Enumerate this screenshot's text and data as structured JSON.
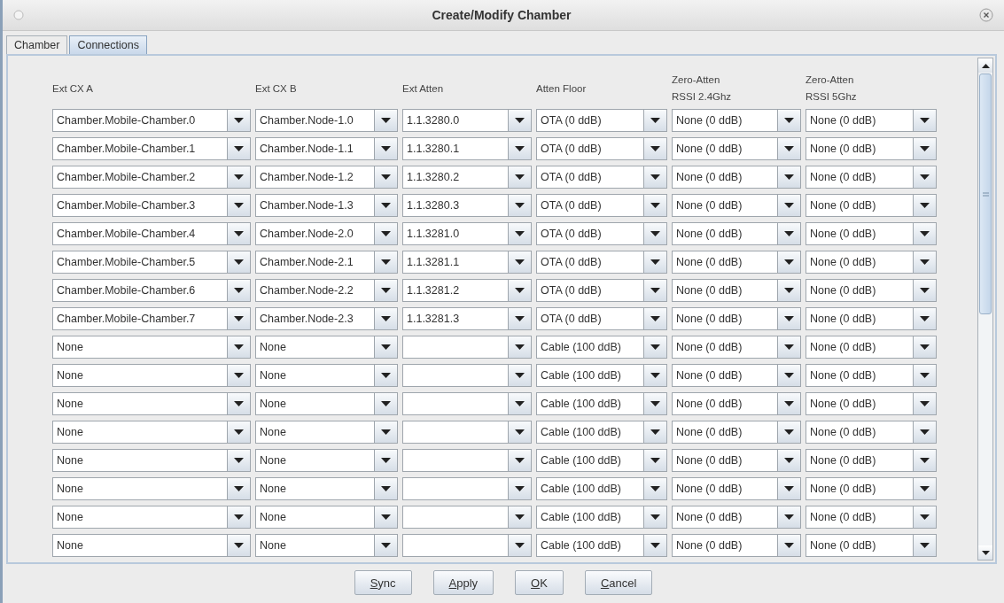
{
  "window": {
    "title": "Create/Modify Chamber"
  },
  "tabs": [
    {
      "label": "Chamber",
      "selected": false
    },
    {
      "label": "Connections",
      "selected": true
    }
  ],
  "table": {
    "columns": [
      {
        "label": "Ext CX A"
      },
      {
        "label": "Ext CX B"
      },
      {
        "label": "Ext Atten"
      },
      {
        "label": "Atten Floor"
      },
      {
        "label": "Zero-Atten\nRSSI 2.4Ghz"
      },
      {
        "label": "Zero-Atten\nRSSI 5Ghz"
      }
    ],
    "rows": [
      {
        "ext_cx_a": "Chamber.Mobile-Chamber.0",
        "ext_cx_b": "Chamber.Node-1.0",
        "ext_atten": "1.1.3280.0",
        "atten_floor": "OTA (0 ddB)",
        "rssi_24": "None (0 ddB)",
        "rssi_5": "None (0 ddB)"
      },
      {
        "ext_cx_a": "Chamber.Mobile-Chamber.1",
        "ext_cx_b": "Chamber.Node-1.1",
        "ext_atten": "1.1.3280.1",
        "atten_floor": "OTA (0 ddB)",
        "rssi_24": "None (0 ddB)",
        "rssi_5": "None (0 ddB)"
      },
      {
        "ext_cx_a": "Chamber.Mobile-Chamber.2",
        "ext_cx_b": "Chamber.Node-1.2",
        "ext_atten": "1.1.3280.2",
        "atten_floor": "OTA (0 ddB)",
        "rssi_24": "None (0 ddB)",
        "rssi_5": "None (0 ddB)"
      },
      {
        "ext_cx_a": "Chamber.Mobile-Chamber.3",
        "ext_cx_b": "Chamber.Node-1.3",
        "ext_atten": "1.1.3280.3",
        "atten_floor": "OTA (0 ddB)",
        "rssi_24": "None (0 ddB)",
        "rssi_5": "None (0 ddB)"
      },
      {
        "ext_cx_a": "Chamber.Mobile-Chamber.4",
        "ext_cx_b": "Chamber.Node-2.0",
        "ext_atten": "1.1.3281.0",
        "atten_floor": "OTA (0 ddB)",
        "rssi_24": "None (0 ddB)",
        "rssi_5": "None (0 ddB)"
      },
      {
        "ext_cx_a": "Chamber.Mobile-Chamber.5",
        "ext_cx_b": "Chamber.Node-2.1",
        "ext_atten": "1.1.3281.1",
        "atten_floor": "OTA (0 ddB)",
        "rssi_24": "None (0 ddB)",
        "rssi_5": "None (0 ddB)"
      },
      {
        "ext_cx_a": "Chamber.Mobile-Chamber.6",
        "ext_cx_b": "Chamber.Node-2.2",
        "ext_atten": "1.1.3281.2",
        "atten_floor": "OTA (0 ddB)",
        "rssi_24": "None (0 ddB)",
        "rssi_5": "None (0 ddB)"
      },
      {
        "ext_cx_a": "Chamber.Mobile-Chamber.7",
        "ext_cx_b": "Chamber.Node-2.3",
        "ext_atten": "1.1.3281.3",
        "atten_floor": "OTA (0 ddB)",
        "rssi_24": "None (0 ddB)",
        "rssi_5": "None (0 ddB)"
      },
      {
        "ext_cx_a": "None",
        "ext_cx_b": "None",
        "atten_floor": "Cable (100 ddB)",
        "rssi_24": "None (0 ddB)",
        "rssi_5": "None (0 ddB)"
      },
      {
        "ext_cx_a": "None",
        "ext_cx_b": "None",
        "atten_floor": "Cable (100 ddB)",
        "rssi_24": "None (0 ddB)",
        "rssi_5": "None (0 ddB)"
      },
      {
        "ext_cx_a": "None",
        "ext_cx_b": "None",
        "atten_floor": "Cable (100 ddB)",
        "rssi_24": "None (0 ddB)",
        "rssi_5": "None (0 ddB)"
      },
      {
        "ext_cx_a": "None",
        "ext_cx_b": "None",
        "atten_floor": "Cable (100 ddB)",
        "rssi_24": "None (0 ddB)",
        "rssi_5": "None (0 ddB)"
      },
      {
        "ext_cx_a": "None",
        "ext_cx_b": "None",
        "atten_floor": "Cable (100 ddB)",
        "rssi_24": "None (0 ddB)",
        "rssi_5": "None (0 ddB)"
      },
      {
        "ext_cx_a": "None",
        "ext_cx_b": "None",
        "atten_floor": "Cable (100 ddB)",
        "rssi_24": "None (0 ddB)",
        "rssi_5": "None (0 ddB)"
      },
      {
        "ext_cx_a": "None",
        "ext_cx_b": "None",
        "atten_floor": "Cable (100 ddB)",
        "rssi_24": "None (0 ddB)",
        "rssi_5": "None (0 ddB)"
      },
      {
        "ext_cx_a": "None",
        "ext_cx_b": "None",
        "atten_floor": "Cable (100 ddB)",
        "rssi_24": "None (0 ddB)",
        "rssi_5": "None (0 ddB)"
      }
    ]
  },
  "buttons": [
    {
      "label": "Sync"
    },
    {
      "label": "Apply"
    },
    {
      "label": "OK"
    },
    {
      "label": "Cancel"
    }
  ]
}
